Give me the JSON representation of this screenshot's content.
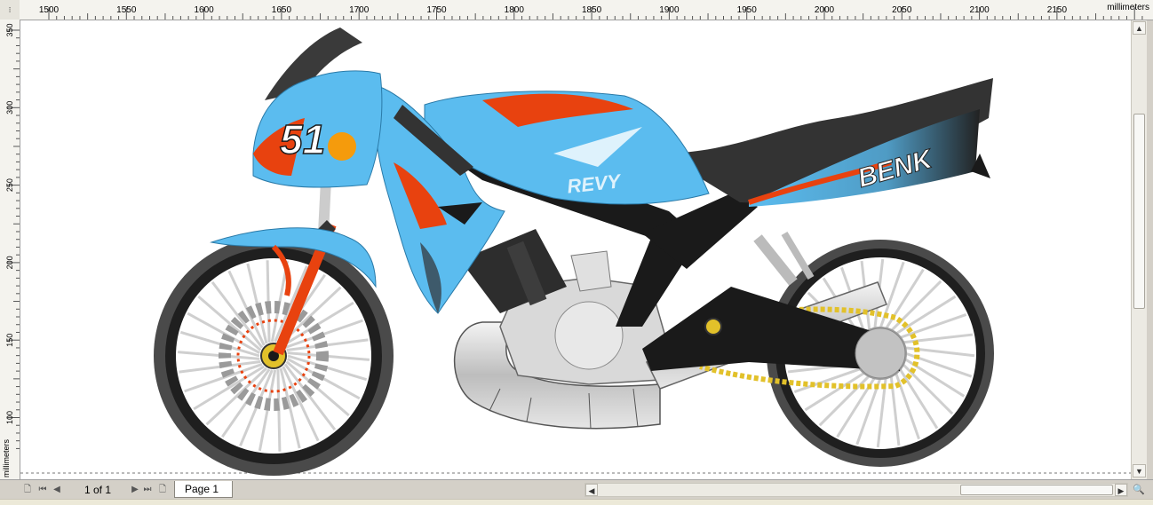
{
  "ruler": {
    "unit_label": "millimeters",
    "corner_label": "⁝",
    "top_ticks": [
      "1500",
      "1550",
      "1600",
      "1650",
      "1700",
      "1750",
      "1800",
      "1850",
      "1900",
      "1950",
      "2000",
      "2050",
      "2100",
      "2150"
    ],
    "left_ticks": [
      "350",
      "300",
      "250",
      "200",
      "150",
      "100"
    ]
  },
  "drawing": {
    "race_number": "51",
    "tank_decal": "REVY",
    "tail_decal": "BENK"
  },
  "pager": {
    "count": "1 of 1",
    "tab_label": "Page 1"
  },
  "colors": {
    "body_blue": "#5bbcef",
    "accent_orange": "#e8420f",
    "frame_black": "#1a1a1a",
    "chain_gold": "#e2c12a"
  },
  "icons": [
    "first-page-icon",
    "prev-page-icon",
    "next-page-icon",
    "last-page-icon",
    "add-page-icon",
    "zoom-icon",
    "scroll-arrow-icon"
  ]
}
